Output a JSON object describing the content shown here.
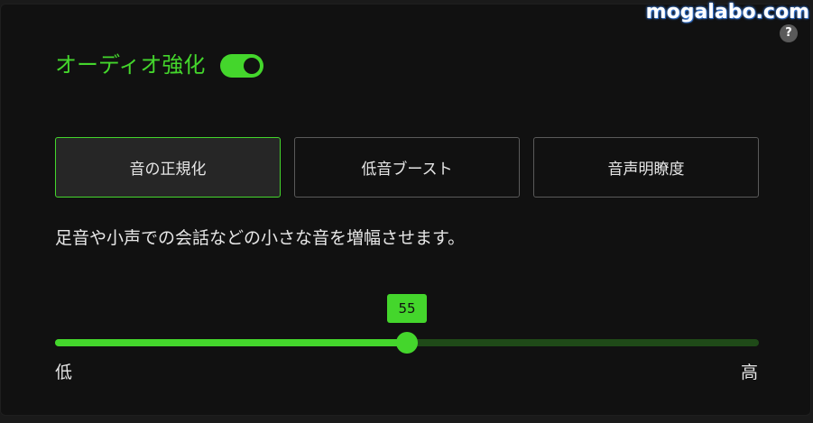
{
  "watermark": "mogalabo.com",
  "help_icon": "?",
  "audio_enhance": {
    "title": "オーディオ強化",
    "enabled": true
  },
  "modes": [
    {
      "label": "音の正規化",
      "selected": true
    },
    {
      "label": "低音ブースト",
      "selected": false
    },
    {
      "label": "音声明瞭度",
      "selected": false
    }
  ],
  "description": "足音や小声での会話などの小さな音を増幅させます。",
  "slider": {
    "value": "55",
    "min_label": "低",
    "max_label": "高"
  },
  "colors": {
    "accent": "#44d62c",
    "track_inactive": "#1f4a18",
    "background": "#111111"
  }
}
